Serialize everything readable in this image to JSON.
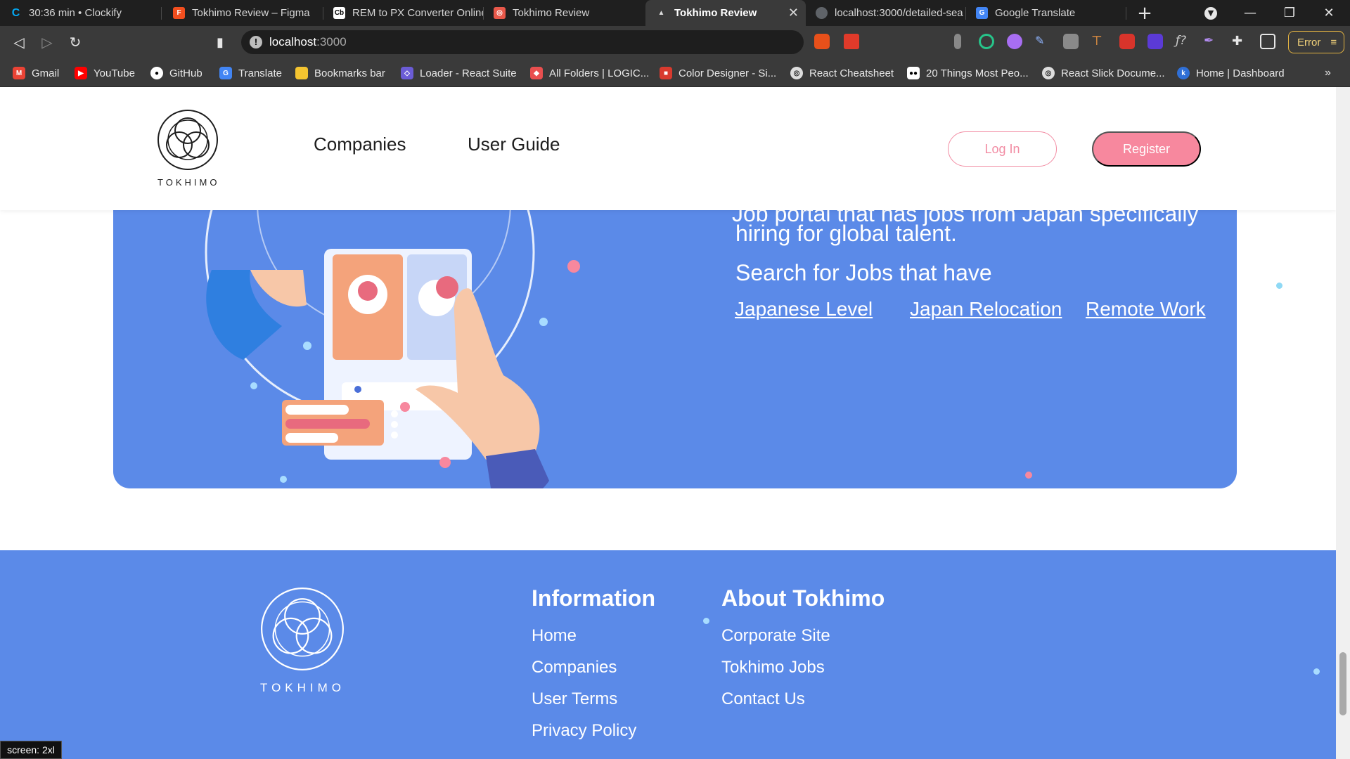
{
  "browser": {
    "tabs": [
      {
        "label": "30:36 min • Clockify",
        "icon": "clockify-icon",
        "color": "#03a9f4"
      },
      {
        "label": "Tokhimo Review – Figma",
        "icon": "figma-icon",
        "color": "#f24e1e"
      },
      {
        "label": "REM to PX Converter Online",
        "icon": "cb-icon",
        "color": "#ffffff"
      },
      {
        "label": "Tokhimo Review",
        "icon": "tokhimo-icon",
        "color": "#e8584a"
      },
      {
        "label": "Tokhimo Review",
        "icon": "react-icon",
        "color": "#222222"
      },
      {
        "label": "localhost:3000/detailed-sea",
        "icon": "globe-icon",
        "color": "#9e9e9e"
      },
      {
        "label": "Google Translate",
        "icon": "translate-icon",
        "color": "#4285f4"
      }
    ],
    "new_tab_label": "+",
    "url": {
      "host": "localhost",
      "port": ":3000"
    },
    "error_label": "Error",
    "bookmarks": [
      {
        "label": "Gmail",
        "color": "#ea4335"
      },
      {
        "label": "YouTube",
        "color": "#ff0000"
      },
      {
        "label": "GitHub",
        "color": "#ffffff"
      },
      {
        "label": "Translate",
        "color": "#4285f4"
      },
      {
        "label": "Bookmarks bar",
        "color": "#f4c430"
      },
      {
        "label": "Loader - React Suite",
        "color": "#6b5cd6"
      },
      {
        "label": "All Folders | LOGIC...",
        "color": "#e94f4f"
      },
      {
        "label": "Color Designer - Si...",
        "color": "#d83a2e"
      },
      {
        "label": "React Cheatsheet",
        "color": "#dddddd"
      },
      {
        "label": "20 Things Most Peo...",
        "color": "#ffffff"
      },
      {
        "label": "React Slick Docume...",
        "color": "#dddddd"
      },
      {
        "label": "Home | Dashboard",
        "color": "#2f6fd6"
      }
    ],
    "more_bookmarks": "»"
  },
  "header": {
    "logo_text": "TOKHIMO",
    "nav": [
      "Companies",
      "User Guide"
    ],
    "login_label": "Log In",
    "register_label": "Register"
  },
  "hero": {
    "cut_line": "Job portal that has jobs from Japan specifically",
    "line2": "hiring for global talent.",
    "subtitle": "Search for Jobs that have",
    "links": [
      "Japanese Level",
      "Japan Relocation",
      "Remote Work"
    ]
  },
  "footer": {
    "logo_text": "TOKHIMO",
    "info_heading": "Information",
    "info_links": [
      "Home",
      "Companies",
      "User Terms",
      "Privacy Policy"
    ],
    "about_heading": "About Tokhimo",
    "about_links": [
      "Corporate Site",
      "Tokhimo Jobs",
      "Contact Us"
    ]
  },
  "screen_badge": "screen: 2xl",
  "colors": {
    "brand_blue": "#5b8ae8",
    "brand_pink": "#f7889e"
  }
}
